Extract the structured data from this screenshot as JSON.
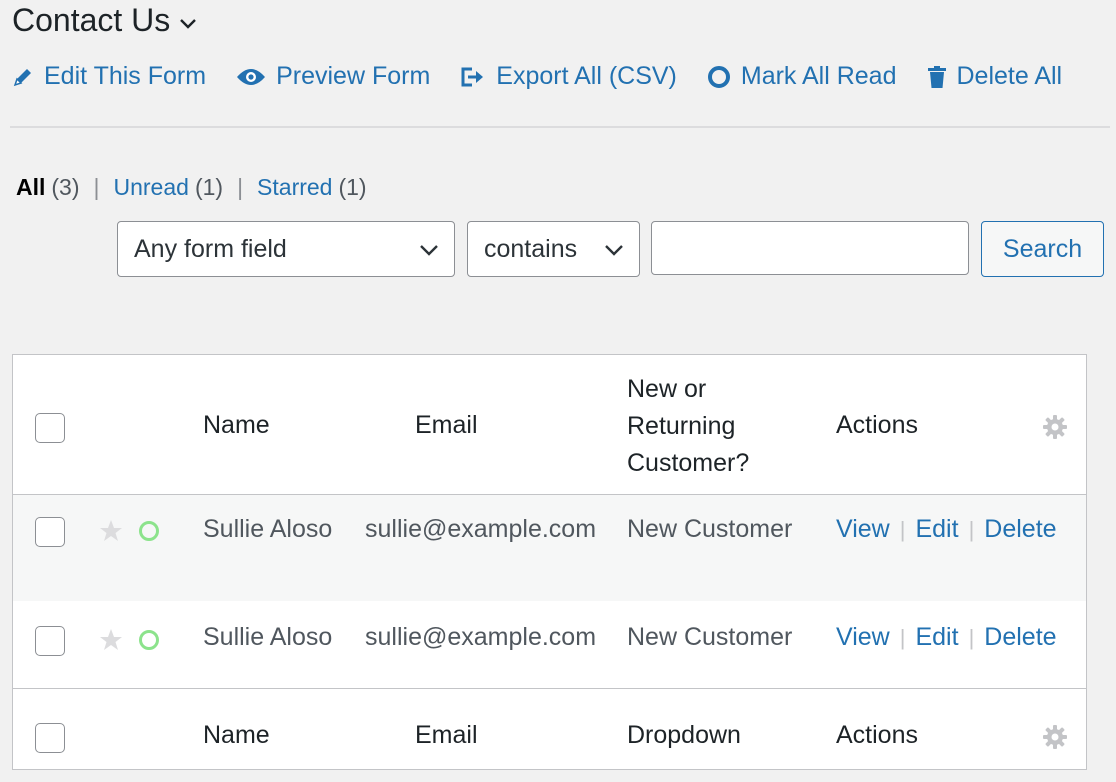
{
  "header": {
    "title": "Contact Us",
    "actions": [
      {
        "label": "Edit This Form",
        "icon": "pencil-icon"
      },
      {
        "label": "Preview Form",
        "icon": "eye-icon"
      },
      {
        "label": "Export All (CSV)",
        "icon": "export-icon"
      },
      {
        "label": "Mark All Read",
        "icon": "circle-icon"
      },
      {
        "label": "Delete All",
        "icon": "trash-icon"
      }
    ]
  },
  "filters": {
    "views": [
      {
        "label": "All",
        "count": "(3)",
        "current": true
      },
      {
        "label": "Unread",
        "count": "(1)",
        "current": false
      },
      {
        "label": "Starred",
        "count": "(1)",
        "current": false
      }
    ],
    "separator": "|"
  },
  "search": {
    "field_select": "Any form field",
    "operator_select": "contains",
    "input_value": "",
    "button_label": "Search"
  },
  "table": {
    "columns": {
      "name": "Name",
      "email": "Email",
      "customer": "New or Returning Customer?",
      "actions": "Actions"
    },
    "footer_columns": {
      "name": "Name",
      "email": "Email",
      "customer": "Dropdown",
      "actions": "Actions"
    },
    "rows": [
      {
        "name": "Sullie Aloso",
        "email": "sullie@example.com",
        "customer": "New Customer",
        "actions": [
          "View",
          "Edit",
          "Delete"
        ]
      },
      {
        "name": "Sullie Aloso",
        "email": "sullie@example.com",
        "customer": "New Customer",
        "actions": [
          "View",
          "Edit",
          "Delete"
        ]
      }
    ],
    "action_separator": "|"
  },
  "colors": {
    "link": "#2271b1",
    "unread_indicator": "#8ce38c",
    "star": "#dcdcde"
  }
}
